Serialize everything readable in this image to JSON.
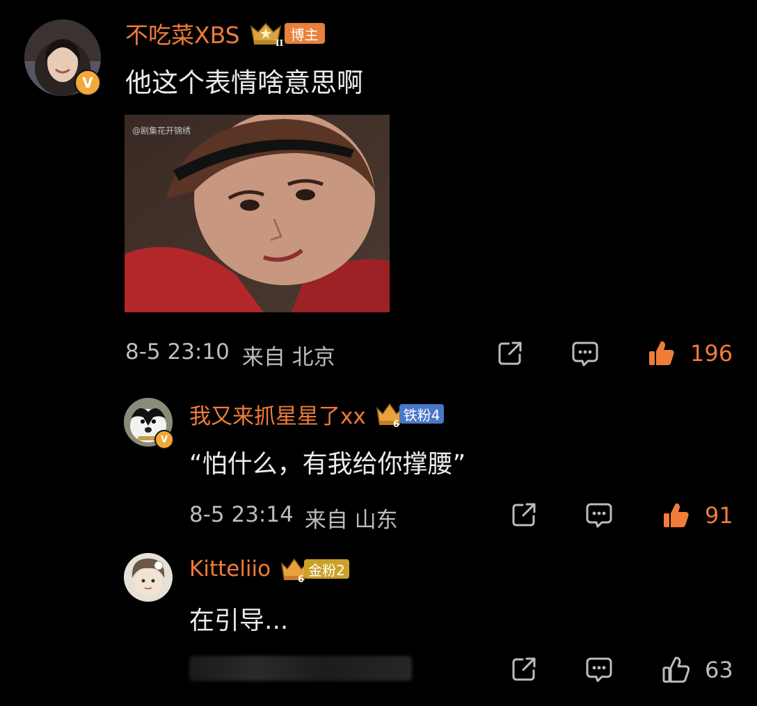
{
  "comments": [
    {
      "username": "不吃菜XBS",
      "badge_label": "博主",
      "badge_level": "II",
      "text": "他这个表情啥意思啊",
      "image_watermark": "@剧集花开锦绣",
      "timestamp": "8-5 23:10",
      "location": "来自 北京",
      "likes": "196",
      "liked": true
    },
    {
      "username": "我又来抓星星了xx",
      "badge_label": "铁粉4",
      "badge_level": "6",
      "text": "“怕什么，有我给你撑腰”",
      "timestamp": "8-5 23:14",
      "location": "来自 山东",
      "likes": "91",
      "liked": true
    },
    {
      "username": "Kitteliio",
      "badge_label": "金粉2",
      "badge_level": "6",
      "text": "在引导...",
      "likes": "63",
      "liked": false
    }
  ],
  "verified_mark": "V",
  "icons": {
    "share": "share-icon",
    "comment": "comment-icon",
    "like": "thumbs-up-icon"
  },
  "colors": {
    "username": "#f07c39",
    "like_active": "#f07c39",
    "badge_blogger": "#e8813c",
    "badge_iron": "#4a78c8",
    "badge_gold": "#c9a227",
    "verified": "#f2a83a"
  }
}
